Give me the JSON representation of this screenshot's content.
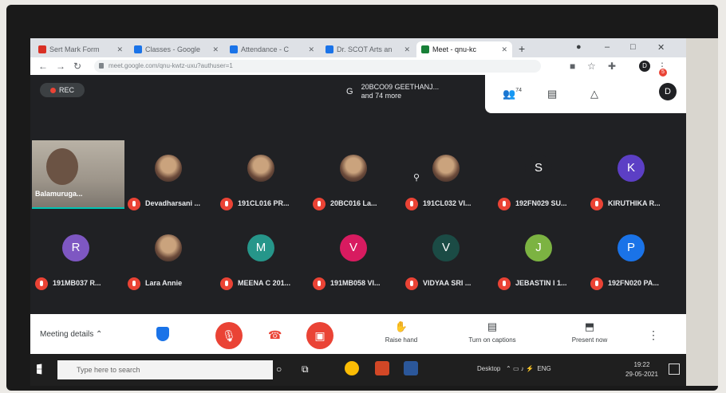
{
  "browser": {
    "tabs": [
      {
        "label": "Sert Mark Form",
        "color": "#d93025"
      },
      {
        "label": "Classes - Google",
        "color": "#1a73e8"
      },
      {
        "label": "Attendance - C",
        "color": "#1a73e8"
      },
      {
        "label": "Dr. SCOT Arts an",
        "color": "#1a73e8"
      },
      {
        "label": "Meet - qnu-kc",
        "color": "#188038"
      }
    ],
    "new_tab": "+",
    "url": "meet.google.com/qnu-kwtz-uxu?authuser=1"
  },
  "meet": {
    "rec_label": "REC",
    "presenter_initial": "G",
    "presenter_line1": "20BCO09 GEETHANJ...",
    "presenter_line2": "and 74 more",
    "participant_count": "74",
    "self_initial": "D",
    "self_badge": "5",
    "self_name": "Balamuruga...",
    "row1": [
      {
        "name": "Devadharsani ...",
        "type": "photo"
      },
      {
        "name": "191CL016 PR...",
        "type": "photo"
      },
      {
        "name": "20BC016 La...",
        "type": "photo"
      },
      {
        "name": "191CL032 VI...",
        "type": "photo"
      },
      {
        "name": "192FN029 SU...",
        "type": "letter",
        "letter": "S",
        "color": "#202124"
      },
      {
        "name": "KIRUTHIKA R...",
        "type": "letter",
        "letter": "K",
        "color": "#5c3fc5"
      }
    ],
    "row2": [
      {
        "name": "191MB037 R...",
        "type": "letter",
        "letter": "R",
        "color": "#7e57c2"
      },
      {
        "name": "Lara Annie",
        "type": "photo"
      },
      {
        "name": "MEENA C 201...",
        "type": "letter",
        "letter": "M",
        "color": "#26968a"
      },
      {
        "name": "191MB058 VI...",
        "type": "letter",
        "letter": "V",
        "color": "#d81b60"
      },
      {
        "name": "VIDYAA SRI ...",
        "type": "letter",
        "letter": "V",
        "color": "#1b4b45"
      },
      {
        "name": "JEBASTIN I 1...",
        "type": "letter",
        "letter": "J",
        "color": "#7cb342"
      },
      {
        "name": "192FN020 PA...",
        "type": "letter",
        "letter": "P",
        "color": "#1a73e8"
      }
    ],
    "meeting_details": "Meeting details",
    "raise_hand": "Raise hand",
    "captions": "Turn on captions",
    "present": "Present now"
  },
  "taskbar": {
    "search_placeholder": "Type here to search",
    "tray": "Desktop",
    "lang": "ENG",
    "time": "19:22",
    "date": "29-05-2021"
  }
}
